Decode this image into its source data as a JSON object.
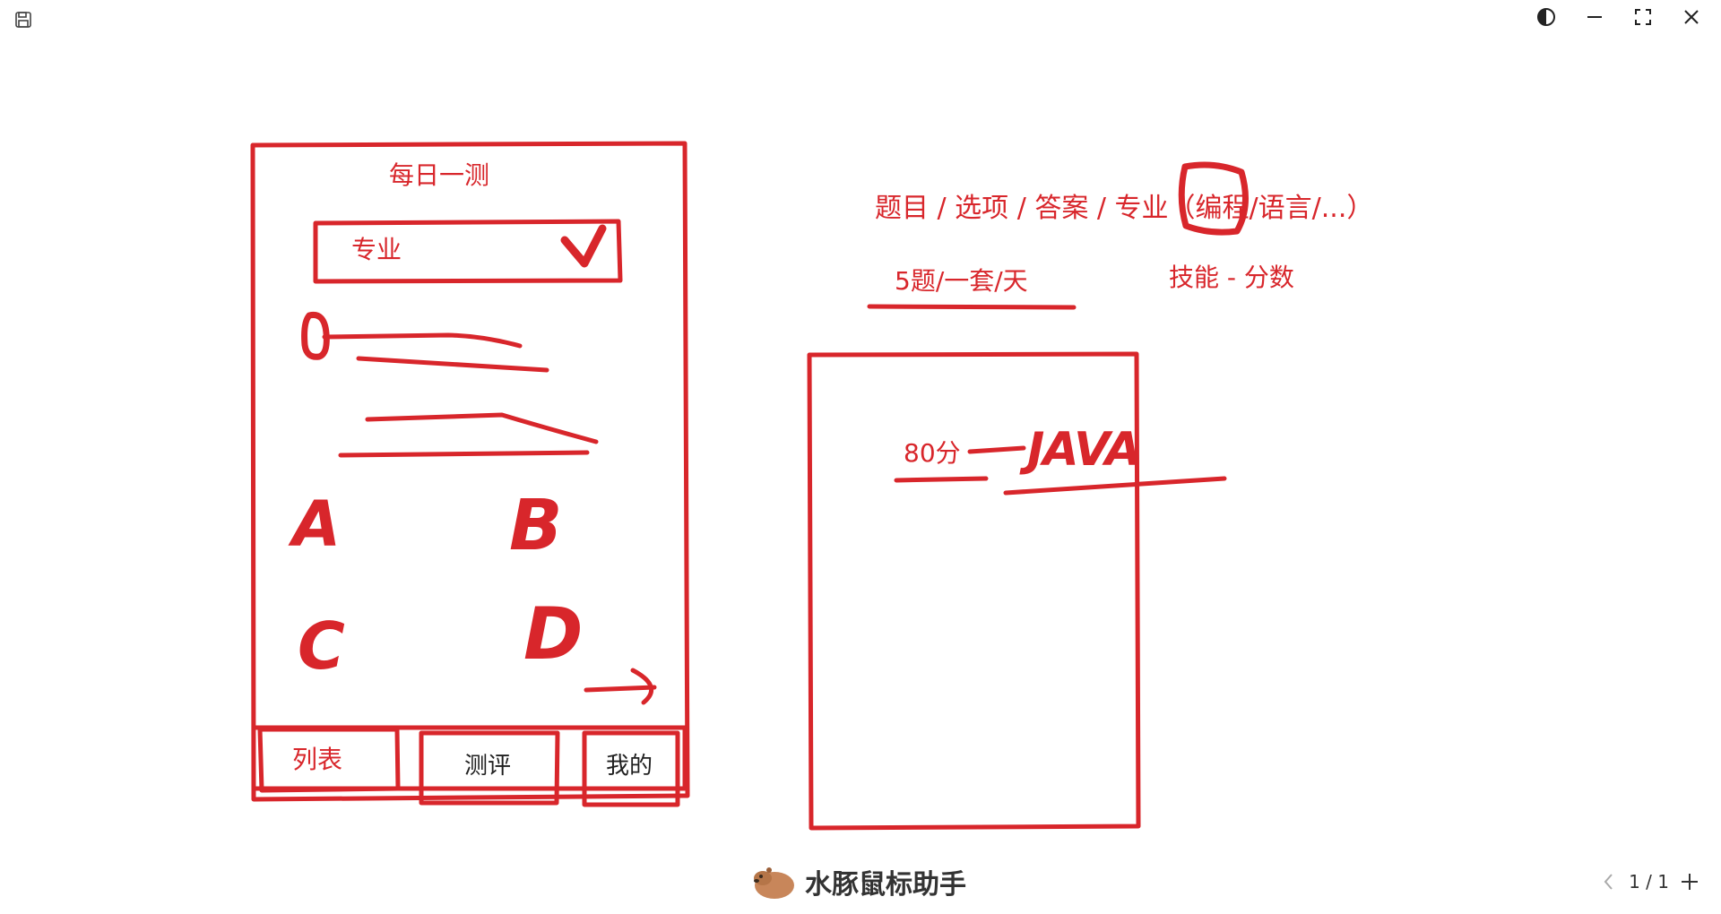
{
  "toolbar": {
    "save_icon": "save-icon"
  },
  "window_controls": [
    {
      "name": "theme-toggle-button",
      "icon": "contrast-icon"
    },
    {
      "name": "minimize-button",
      "icon": "minus-icon"
    },
    {
      "name": "fullscreen-button",
      "icon": "expand-icon"
    },
    {
      "name": "close-button",
      "icon": "close-icon"
    }
  ],
  "sketch": {
    "phone": {
      "title": "每日一测",
      "dropdown_label": "专业",
      "options": [
        "A",
        "B",
        "C",
        "D"
      ],
      "tabs": [
        "列表",
        "测评",
        "我的"
      ]
    },
    "notes": {
      "fields": "题目 / 选项 / 答案 / 专业（编程/语言/...）",
      "rule": "5题/一套/天",
      "skill": "技能 - 分数"
    },
    "card": {
      "score": "80分",
      "skill": "JAVA"
    }
  },
  "footer": {
    "brand": "水豚鼠标助手",
    "page_indicator": "1 / 1",
    "prev_icon": "chevron-left-icon",
    "add_icon": "plus-icon"
  },
  "colors": {
    "ink": "#d8262b",
    "text_dark": "#1f1f1f",
    "capybara": "#c8865a"
  }
}
